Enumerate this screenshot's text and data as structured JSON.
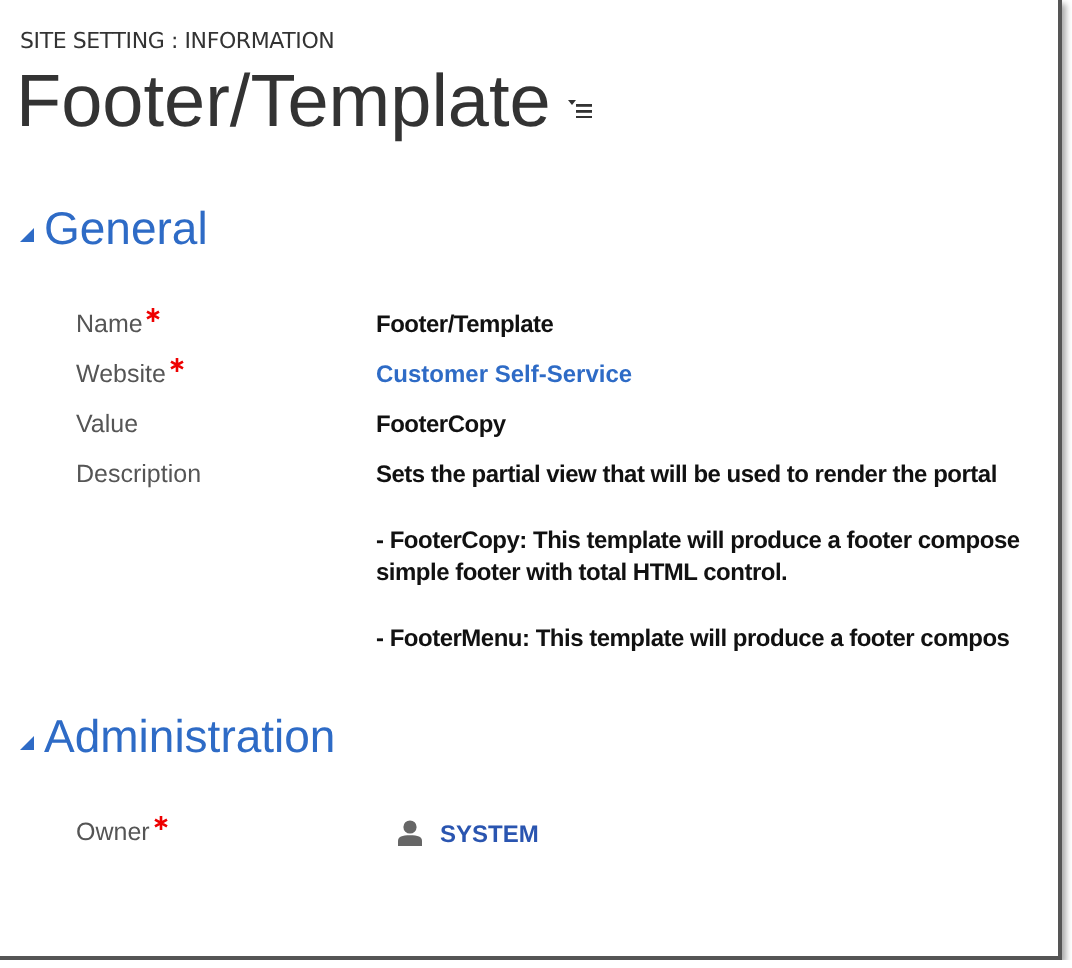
{
  "breadcrumb": "SITE SETTING : INFORMATION",
  "title": "Footer/Template",
  "sections": [
    {
      "heading": "General",
      "expanded": true,
      "fields": [
        {
          "label": "Name",
          "required": true,
          "kind": "text",
          "value": [
            "Footer/Template"
          ]
        },
        {
          "label": "Website",
          "required": true,
          "kind": "link",
          "value": [
            "Customer Self-Service"
          ]
        },
        {
          "label": "Value",
          "required": false,
          "kind": "text",
          "value": [
            "FooterCopy"
          ]
        },
        {
          "label": "Description",
          "required": false,
          "kind": "text",
          "value": [
            "Sets the partial view that will be used to render the portal",
            "- FooterCopy: This template will produce a footer compose\nsimple footer with total HTML control.",
            "- FooterMenu: This template will produce a footer compos"
          ]
        }
      ]
    },
    {
      "heading": "Administration",
      "expanded": true,
      "fields": [
        {
          "label": "Owner",
          "required": true,
          "kind": "user",
          "value": [
            "SYSTEM"
          ]
        }
      ]
    }
  ]
}
